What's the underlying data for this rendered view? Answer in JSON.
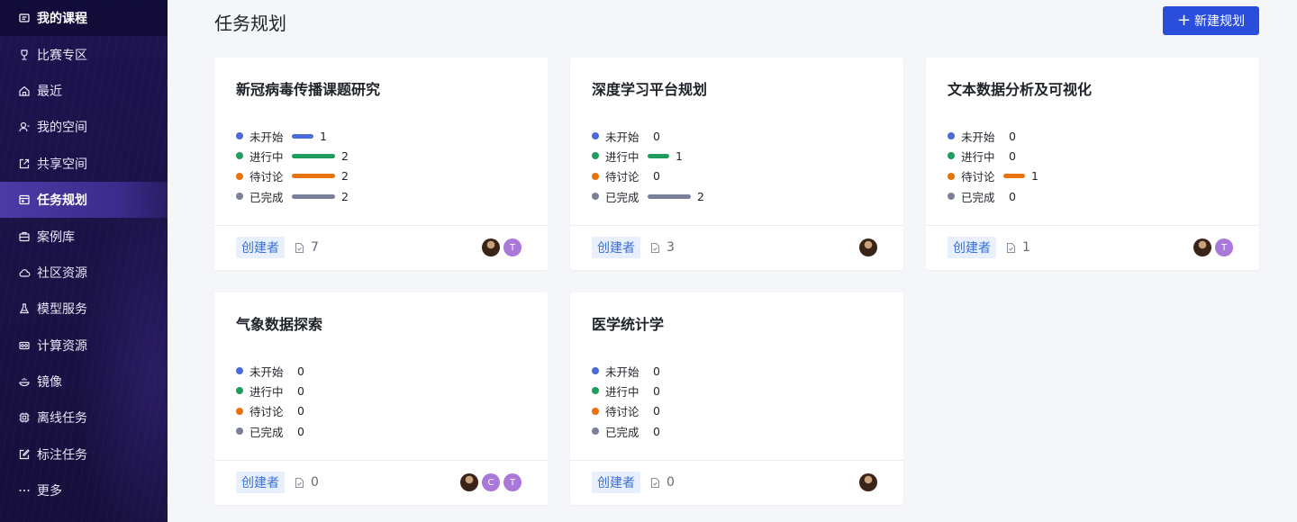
{
  "sidebar": {
    "items": [
      {
        "label": "我的课程",
        "icon": "course-icon"
      },
      {
        "label": "比赛专区",
        "icon": "trophy-icon"
      },
      {
        "label": "最近",
        "icon": "home-icon"
      },
      {
        "label": "我的空间",
        "icon": "user-icon"
      },
      {
        "label": "共享空间",
        "icon": "share-icon"
      },
      {
        "label": "任务规划",
        "icon": "task-icon"
      },
      {
        "label": "案例库",
        "icon": "case-icon"
      },
      {
        "label": "社区资源",
        "icon": "cloud-icon"
      },
      {
        "label": "模型服务",
        "icon": "flask-icon"
      },
      {
        "label": "计算资源",
        "icon": "compute-icon"
      },
      {
        "label": "镜像",
        "icon": "image-icon"
      },
      {
        "label": "离线任务",
        "icon": "chip-icon"
      },
      {
        "label": "标注任务",
        "icon": "edit-icon"
      },
      {
        "label": "更多",
        "icon": "more-icon"
      }
    ]
  },
  "header": {
    "title": "任务规划",
    "new_button_label": "新建规划"
  },
  "status_labels": [
    "未开始",
    "进行中",
    "待讨论",
    "已完成"
  ],
  "status_colors": [
    "#4a6bd6",
    "#1f9d5c",
    "#e8720c",
    "#7a8099"
  ],
  "cards": [
    {
      "title": "新冠病毒传播课题研究",
      "counts": [
        1,
        2,
        2,
        2
      ],
      "role": "创建者",
      "docs": 7,
      "avatars": [
        "photo",
        "T"
      ]
    },
    {
      "title": "深度学习平台规划",
      "counts": [
        0,
        1,
        0,
        2
      ],
      "role": "创建者",
      "docs": 3,
      "avatars": [
        "photo"
      ]
    },
    {
      "title": "文本数据分析及可视化",
      "counts": [
        0,
        0,
        1,
        0
      ],
      "role": "创建者",
      "docs": 1,
      "avatars": [
        "photo",
        "T"
      ]
    },
    {
      "title": "气象数据探索",
      "counts": [
        0,
        0,
        0,
        0
      ],
      "role": "创建者",
      "docs": 0,
      "avatars": [
        "photo",
        "C",
        "T"
      ]
    },
    {
      "title": "医学统计学",
      "counts": [
        0,
        0,
        0,
        0
      ],
      "role": "创建者",
      "docs": 0,
      "avatars": [
        "photo"
      ]
    }
  ]
}
